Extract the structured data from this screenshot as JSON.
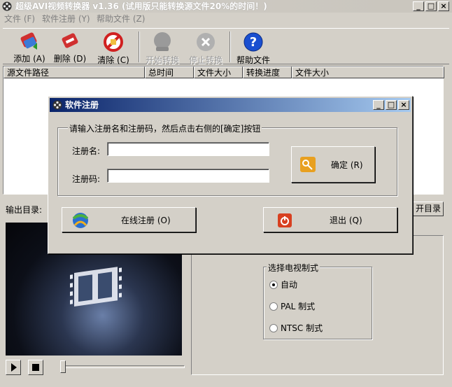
{
  "window": {
    "title": "超级AVI视频转换器 v1.36 (试用版只能转换源文件20%的时间！)",
    "min": "_",
    "max": "□",
    "close": "×"
  },
  "menu": [
    "文件 (F)",
    "软件注册 (Y)",
    "帮助文件 (Z)"
  ],
  "toolbar": {
    "add": "添加 (A)",
    "delete": "删除 (D)",
    "clear": "清除 (C)",
    "start": "开始转换",
    "stop": "停止转换",
    "help": "帮助文件"
  },
  "list": {
    "columns": [
      "源文件路径",
      "总时间",
      "文件大小",
      "转换进度",
      "文件大小"
    ]
  },
  "output": {
    "label": "输出目录:",
    "open_button": "开目录"
  },
  "tv": {
    "group_title": "选择电视制式",
    "options": [
      "自动",
      "PAL 制式",
      "NTSC 制式"
    ],
    "selected": "自动"
  },
  "dialog": {
    "title": "软件注册",
    "group_title": "请输入注册名和注册码，然后点击右侧的[确定]按钮",
    "name_label": "注册名:",
    "code_label": "注册码:",
    "name_value": "",
    "code_value": "",
    "ok_button": "确定 (R)",
    "online_button": "在线注册 (O)",
    "exit_button": "退出 (Q)"
  }
}
